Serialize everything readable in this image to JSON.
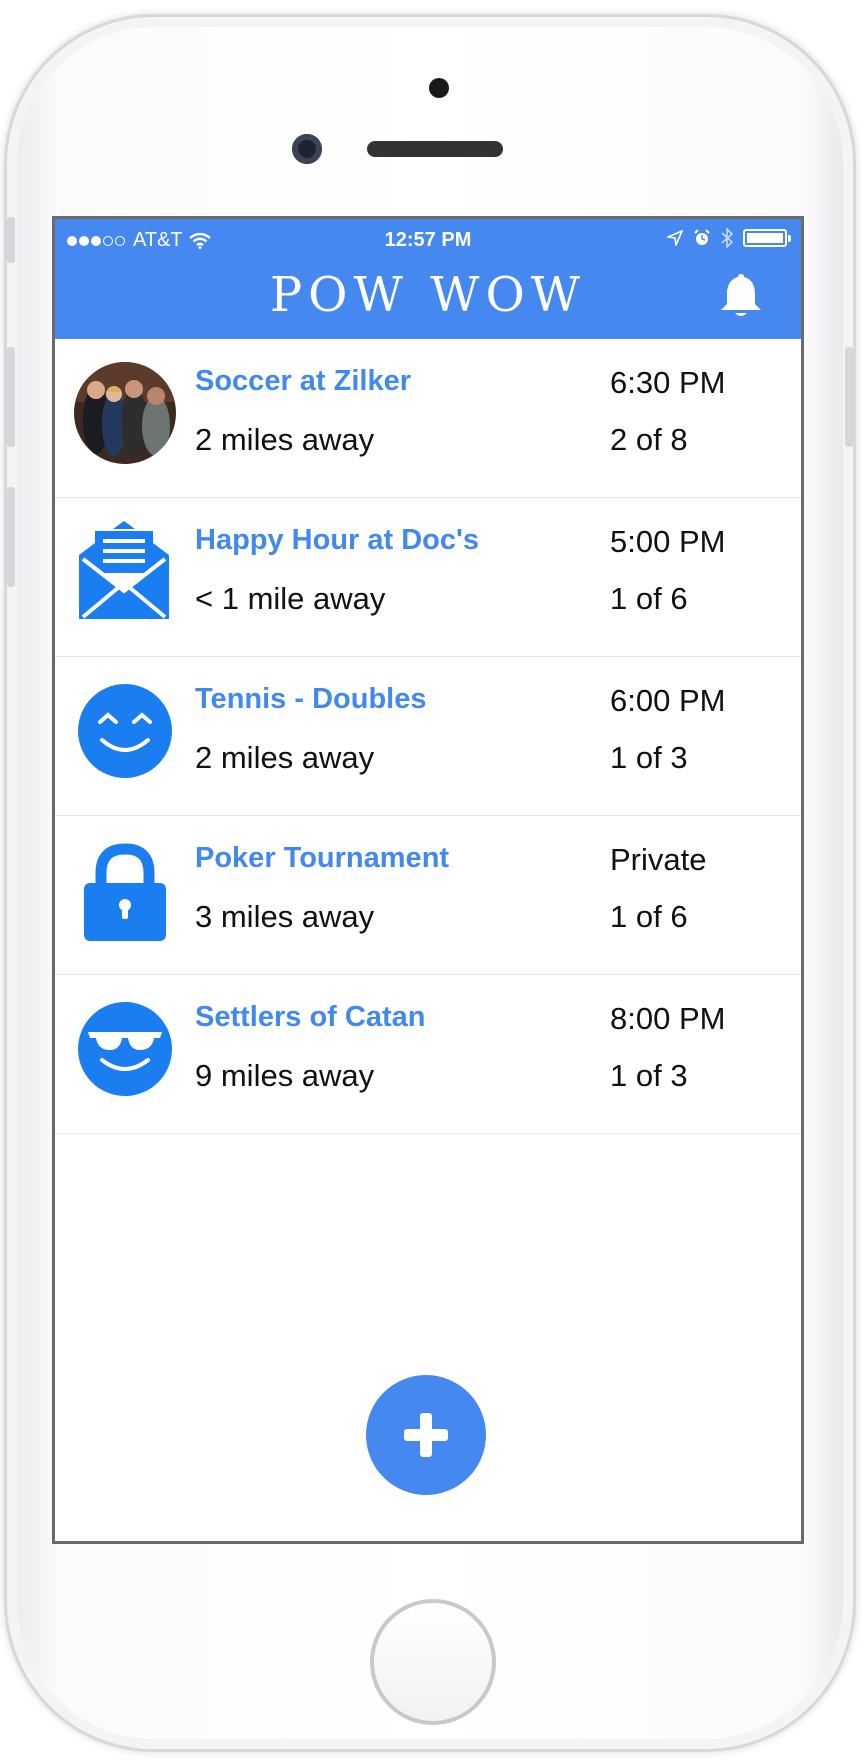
{
  "status_bar": {
    "carrier": "AT&T",
    "time": "12:57 PM",
    "icons": [
      "signal-dots-icon",
      "wifi-icon",
      "location-arrow-icon",
      "alarm-icon",
      "bluetooth-icon",
      "battery-icon"
    ]
  },
  "header": {
    "title": "POW WOW",
    "bell_icon": "bell-icon",
    "background": "#4589f0"
  },
  "events": [
    {
      "title": "Soccer at Zilker",
      "distance": "2 miles away",
      "time": "6:30 PM",
      "count": "2 of 8",
      "icon": "group-photo"
    },
    {
      "title": "Happy Hour at Doc's",
      "distance": "< 1 mile away",
      "time": "5:00 PM",
      "count": "1 of 6",
      "icon": "envelope-icon"
    },
    {
      "title": "Tennis - Doubles",
      "distance": "2 miles away",
      "time": "6:00 PM",
      "count": "1 of 3",
      "icon": "happy-face-icon"
    },
    {
      "title": "Poker Tournament",
      "distance": "3 miles away",
      "time": "Private",
      "count": "1 of 6",
      "icon": "lock-icon"
    },
    {
      "title": "Settlers of Catan",
      "distance": "9 miles away",
      "time": "8:00 PM",
      "count": "1 of 3",
      "icon": "sunglasses-face-icon"
    }
  ],
  "fab": {
    "icon": "plus-icon"
  },
  "colors": {
    "accent": "#4589f0",
    "title_text": "#4189ee",
    "body_text": "#111111"
  }
}
